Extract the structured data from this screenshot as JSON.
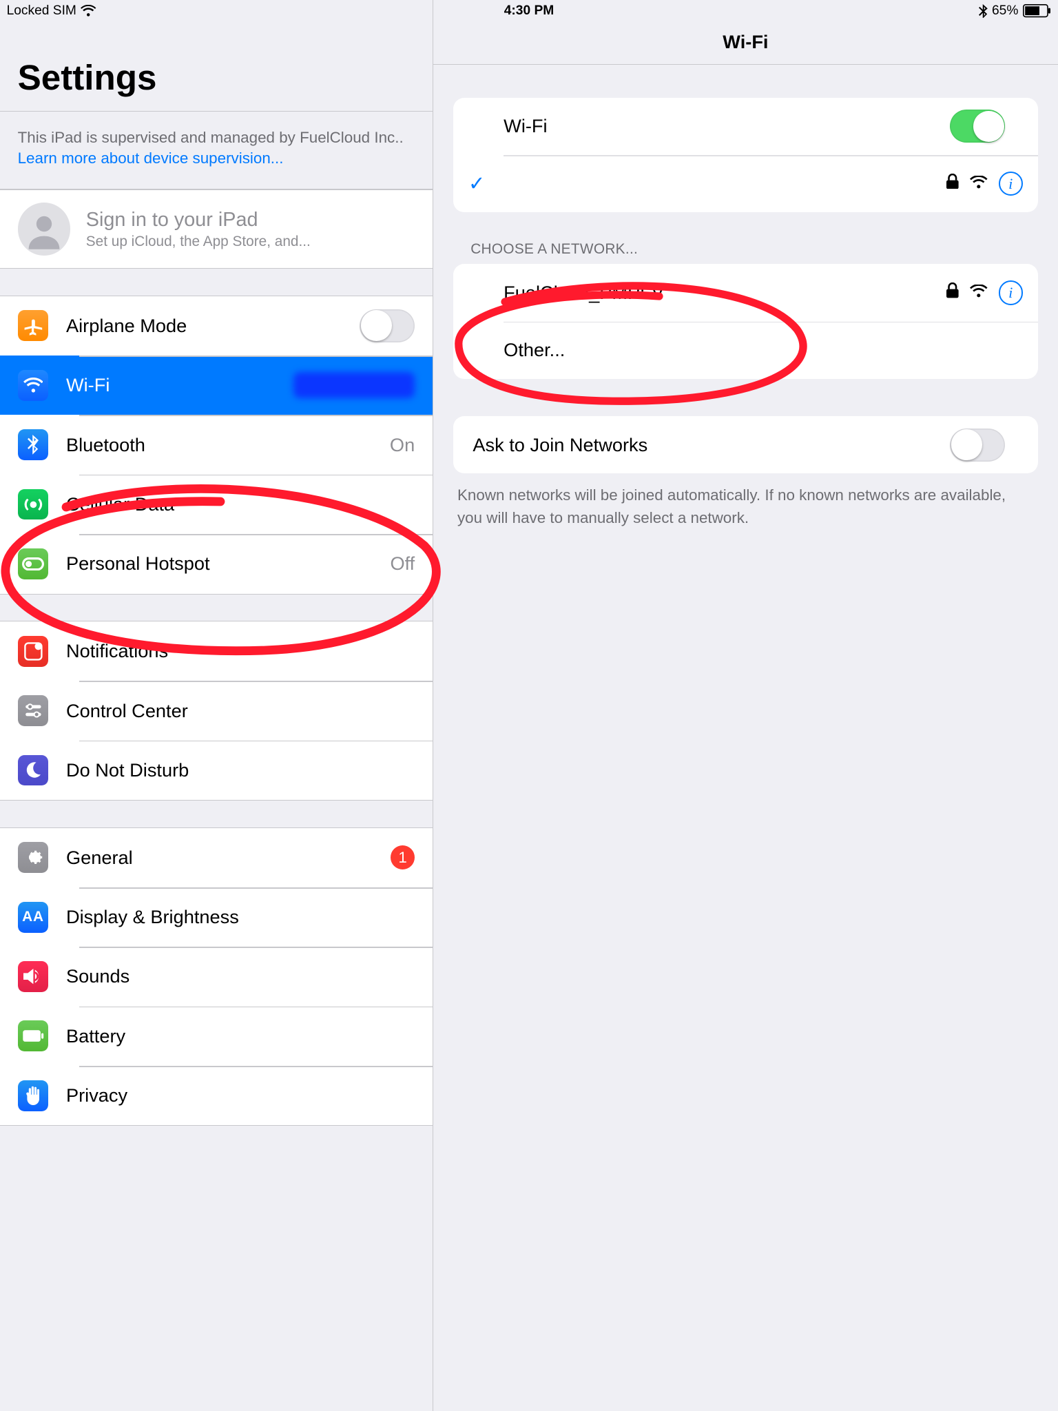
{
  "statusbar": {
    "left_text": "Locked SIM",
    "time": "4:30 PM",
    "battery_pct": "65%"
  },
  "sidebar": {
    "title": "Settings",
    "supervision_text": "This iPad is supervised and managed by FuelCloud Inc.. ",
    "supervision_link": "Learn more about device supervision...",
    "signin_title": "Sign in to your iPad",
    "signin_sub": "Set up iCloud, the App Store, and...",
    "items": {
      "airplane": {
        "label": "Airplane Mode"
      },
      "wifi": {
        "label": "Wi-Fi"
      },
      "bluetooth": {
        "label": "Bluetooth",
        "value": "On"
      },
      "cellular": {
        "label": "Cellular Data"
      },
      "hotspot": {
        "label": "Personal Hotspot",
        "value": "Off"
      },
      "notifications": {
        "label": "Notifications"
      },
      "control": {
        "label": "Control Center"
      },
      "dnd": {
        "label": "Do Not Disturb"
      },
      "general": {
        "label": "General",
        "badge": "1"
      },
      "display": {
        "label": "Display & Brightness"
      },
      "sounds": {
        "label": "Sounds"
      },
      "battery": {
        "label": "Battery"
      },
      "privacy": {
        "label": "Privacy"
      }
    }
  },
  "detail": {
    "header": "Wi-Fi",
    "wifi_toggle_label": "Wi-Fi",
    "choose_label": "CHOOSE A NETWORK...",
    "networks": [
      {
        "name": "FuelCloud_PMPFV",
        "locked": true
      }
    ],
    "other_label": "Other...",
    "ask_join_label": "Ask to Join Networks",
    "ask_join_footer": "Known networks will be joined automatically. If no known networks are available, you will have to manually select a network."
  },
  "annotations": {
    "note": "Red hand-drawn circles highlight the Wi-Fi sidebar row and the FuelCloud_PMPFV network row."
  }
}
